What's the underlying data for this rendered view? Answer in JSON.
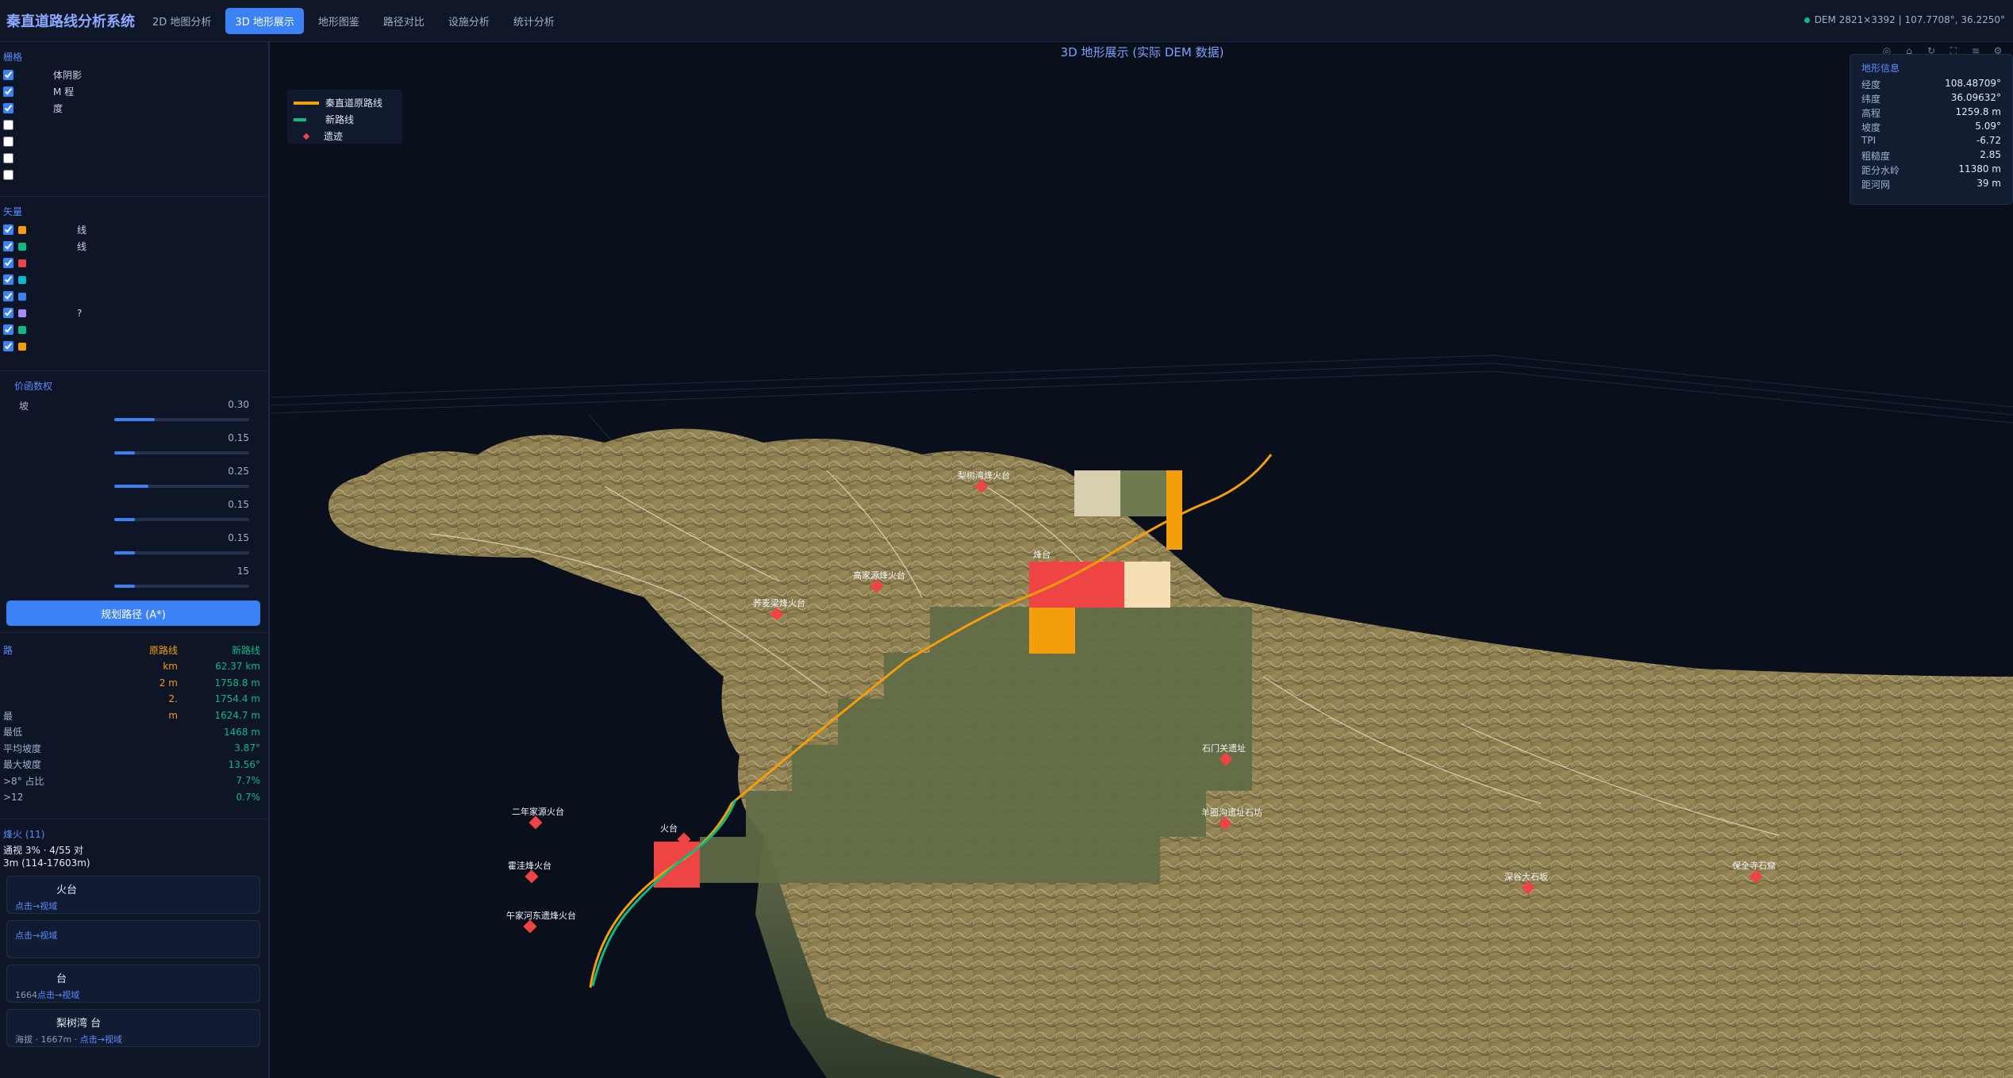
{
  "header": {
    "app_title": "秦直道路线分析系统",
    "tabs": [
      {
        "label": "2D 地图分析",
        "active": false
      },
      {
        "label": "3D 地形展示",
        "active": true
      },
      {
        "label": "地形图鉴",
        "active": false
      },
      {
        "label": "路径对比",
        "active": false
      },
      {
        "label": "设施分析",
        "active": false
      },
      {
        "label": "统计分析",
        "active": false
      }
    ],
    "dem_status": "DEM 2821×3392 | 107.7708°, 36.2250°"
  },
  "sidebar": {
    "layers_title": "栅格",
    "raster_layers": [
      {
        "label": "体阴影",
        "checked": true
      },
      {
        "label": "M 程",
        "checked": true
      },
      {
        "label": "度",
        "checked": true
      },
      {
        "label": "",
        "checked": false
      },
      {
        "label": "",
        "checked": false
      },
      {
        "label": "",
        "checked": false
      },
      {
        "label": "",
        "checked": false
      }
    ],
    "vector_title": "矢量",
    "vector_layers": [
      {
        "label": "线",
        "checked": true,
        "color": "#f59e0b"
      },
      {
        "label": "线",
        "checked": true,
        "color": "#10b981"
      },
      {
        "label": "",
        "checked": true,
        "color": "#ef4444"
      },
      {
        "label": "",
        "checked": true,
        "color": "#06b6d4"
      },
      {
        "label": "",
        "checked": true,
        "color": "#3b82f6"
      },
      {
        "label": "?",
        "checked": true,
        "color": "#a78bfa"
      },
      {
        "label": "",
        "checked": true,
        "color": "#10b981"
      },
      {
        "label": "",
        "checked": true,
        "color": "#f59e0b"
      }
    ],
    "weights_title": "价函数权",
    "weights": [
      {
        "label": "坡",
        "value": "0.30",
        "fraction": 0.3
      },
      {
        "label": "",
        "value": "0.15",
        "fraction": 0.15
      },
      {
        "label": "",
        "value": "0.25",
        "fraction": 0.25
      },
      {
        "label": "",
        "value": "0.15",
        "fraction": 0.15
      },
      {
        "label": "",
        "value": "0.15",
        "fraction": 0.15
      },
      {
        "label": "",
        "value": "15",
        "fraction": 0.15
      }
    ],
    "plan_button": "规划路径 (A*)",
    "stats_title": "路",
    "stats_col_original": "原路线",
    "stats_col_new": "新路线",
    "stats_rows": [
      {
        "label": "",
        "original": "km",
        "new": "62.37 km"
      },
      {
        "label": "",
        "original": "2 m",
        "new": "1758.8 m"
      },
      {
        "label": "",
        "original": "2.",
        "new": "1754.4 m"
      },
      {
        "label": "最",
        "original": "m",
        "new": "1624.7 m"
      },
      {
        "label": "最低",
        "original": "",
        "new": "1468 m"
      },
      {
        "label": "平均坡度",
        "original": "",
        "new": "3.87°"
      },
      {
        "label": "最大坡度",
        "original": "",
        "new": "13.56°"
      },
      {
        "label": ">8° 占比",
        "original": "",
        "new": "7.7%"
      },
      {
        "label": ">12",
        "original": "",
        "new": "0.7%"
      }
    ],
    "beacon_title": "烽火 (11)",
    "beacon_summary_1": "通视 3% · 4/55 对",
    "beacon_summary_2": "3m (114-17603m)",
    "beacons": [
      {
        "name": "火台",
        "meta": "",
        "link": "点击→视域"
      },
      {
        "name": "",
        "meta": "",
        "link": "点击→视域"
      },
      {
        "name": "台",
        "meta": "1664",
        "link": "点击→视域"
      },
      {
        "name": "梨树湾 台",
        "meta": "海拔 · 1667m · ",
        "link": "点击→视域"
      }
    ]
  },
  "viewport": {
    "title": "3D 地形展示 (实际 DEM 数据)",
    "legend": [
      {
        "label": "秦直道原路线",
        "color": "#f59e0b",
        "kind": "line"
      },
      {
        "label": "新路线",
        "color": "#10b981",
        "kind": "line"
      },
      {
        "label": "遗迹",
        "color": "#ef4444",
        "kind": "dot"
      }
    ],
    "toolbar_icons": [
      "camera-icon",
      "home-icon",
      "rotate-icon",
      "fullscreen-icon",
      "layers-icon",
      "settings-icon"
    ],
    "info": {
      "title": "地形信息",
      "rows": [
        {
          "k": "经度",
          "v": "108.48709°"
        },
        {
          "k": "纬度",
          "v": "36.09632°"
        },
        {
          "k": "高程",
          "v": "1259.8 m"
        },
        {
          "k": "坡度",
          "v": "5.09°"
        },
        {
          "k": "TPI",
          "v": "-6.72"
        },
        {
          "k": "粗糙度",
          "v": "2.85"
        },
        {
          "k": "距分水岭",
          "v": "11380 m"
        },
        {
          "k": "距河网",
          "v": "39 m"
        }
      ]
    },
    "sites": [
      {
        "label": "梨树湾烽火台"
      },
      {
        "label": "荞麦梁烽火台"
      },
      {
        "label": "高家源烽火台"
      },
      {
        "label": "二年家源火台"
      },
      {
        "label": "霍洼烽火台"
      },
      {
        "label": "午家河东遗烽火台"
      },
      {
        "label": "石门关遗址"
      },
      {
        "label": "羊圈沟遗址石坊"
      },
      {
        "label": "深谷大石坂"
      },
      {
        "label": "保全寺石窟"
      },
      {
        "label": "火台"
      },
      {
        "label": "烽台"
      }
    ],
    "colors": {
      "terrain": "#8a7a4e",
      "route_original": "#f59e0b",
      "route_new": "#10b981",
      "site": "#ef4444"
    }
  }
}
